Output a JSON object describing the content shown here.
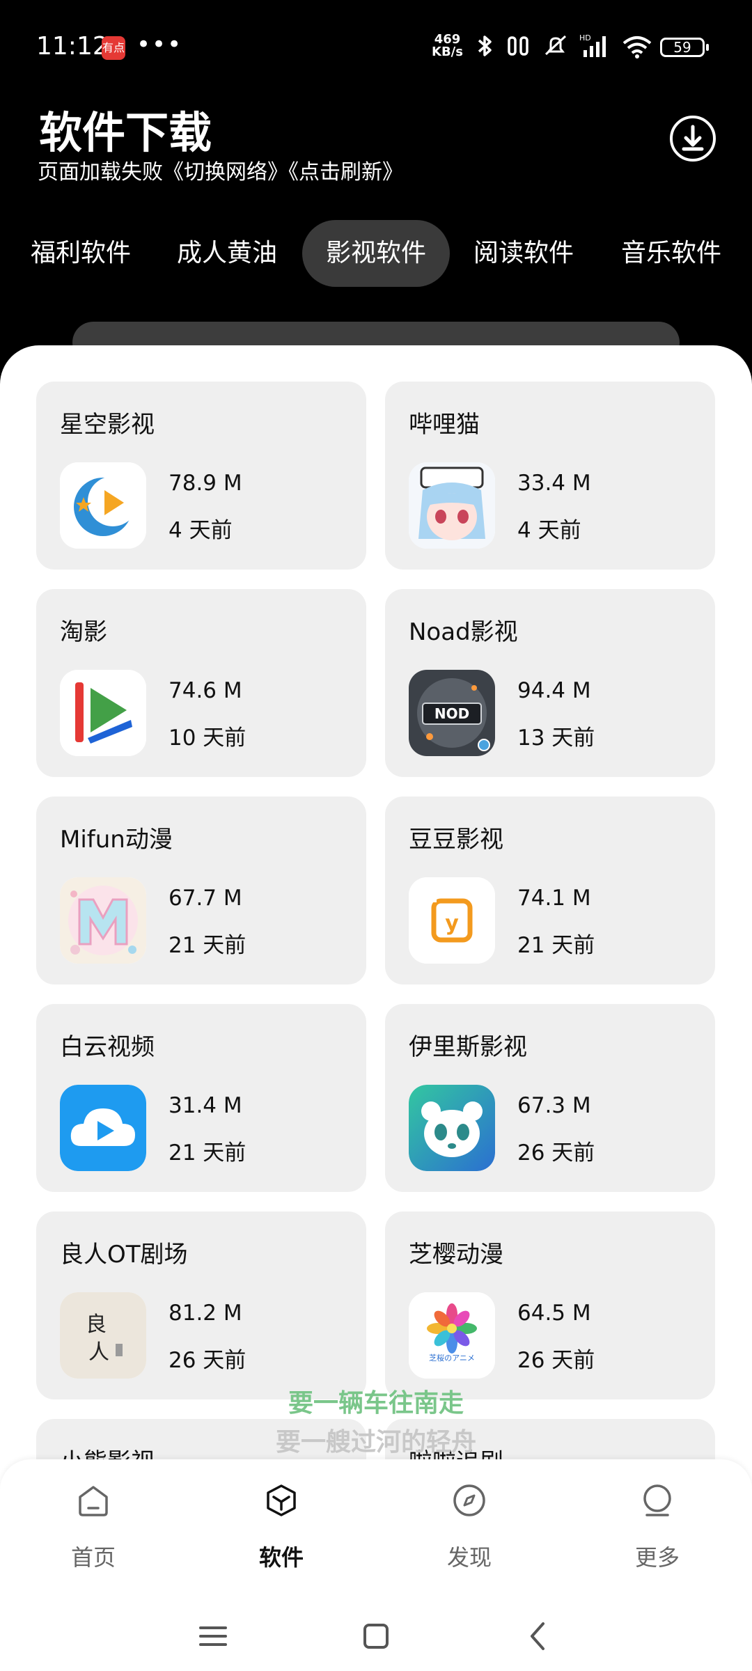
{
  "status": {
    "time": "11:12",
    "app_badge": "有点",
    "more": "•••",
    "rate_top": "469",
    "rate_bottom": "KB/s",
    "battery": "59"
  },
  "header": {
    "title": "软件下载",
    "subtitle": "页面加载失败《切换网络》《点击刷新》"
  },
  "tabs": [
    {
      "label": "福利软件",
      "active": false
    },
    {
      "label": "成人黄油",
      "active": false
    },
    {
      "label": "影视软件",
      "active": true
    },
    {
      "label": "阅读软件",
      "active": false
    },
    {
      "label": "音乐软件",
      "active": false
    }
  ],
  "apps": [
    {
      "name": "星空影视",
      "size": "78.9 M",
      "date": "4 天前",
      "icon": "star-sky-logo-icon"
    },
    {
      "name": "哔哩猫",
      "size": "33.4 M",
      "date": "4 天前",
      "icon": "anime-girl-icon"
    },
    {
      "name": "淘影",
      "size": "74.6 M",
      "date": "10 天前",
      "icon": "play-logo-icon"
    },
    {
      "name": "Noad影视",
      "size": "94.4 M",
      "date": "13 天前",
      "icon": "noad-logo-icon"
    },
    {
      "name": "Mifun动漫",
      "size": "67.7 M",
      "date": "21 天前",
      "icon": "m-letter-icon"
    },
    {
      "name": "豆豆影视",
      "size": "74.1 M",
      "date": "21 天前",
      "icon": "doudou-logo-icon"
    },
    {
      "name": "白云视频",
      "size": "31.4 M",
      "date": "21 天前",
      "icon": "cloud-play-icon"
    },
    {
      "name": "伊里斯影视",
      "size": "67.3 M",
      "date": "26 天前",
      "icon": "panda-icon"
    },
    {
      "name": "良人OT剧场",
      "size": "81.2 M",
      "date": "26 天前",
      "icon": "calligraphy-icon"
    },
    {
      "name": "芝樱动漫",
      "size": "64.5 M",
      "date": "26 天前",
      "icon": "flower-icon"
    },
    {
      "name": "小熊影视",
      "size": "",
      "date": "",
      "icon": ""
    },
    {
      "name": "啦啦追剧",
      "size": "",
      "date": "",
      "icon": ""
    }
  ],
  "lyrics": {
    "line1": "要一辆车往南走",
    "line2": "要一艘过河的轻舟"
  },
  "icon_labels": {
    "calligraphy_1": "良",
    "calligraphy_2": "人",
    "flower_caption": "芝桜のアニメ",
    "doudou_letter": "y"
  },
  "bottom_nav": [
    {
      "label": "首页",
      "icon": "home-icon",
      "active": false
    },
    {
      "label": "软件",
      "icon": "cube-icon",
      "active": true
    },
    {
      "label": "发现",
      "icon": "compass-icon",
      "active": false
    },
    {
      "label": "更多",
      "icon": "more-icon",
      "active": false
    }
  ],
  "colors": {
    "background": "#000000",
    "panel": "#ffffff",
    "card": "#efefef",
    "active_tab": "#3a3a3a",
    "lyric_green": "#7ac68a"
  }
}
